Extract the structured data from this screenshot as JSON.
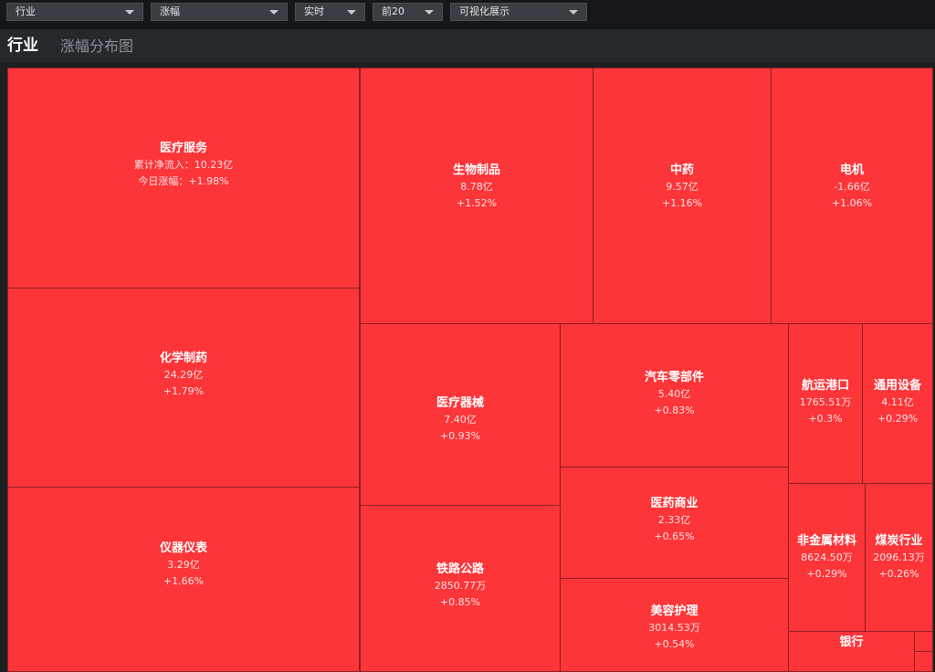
{
  "toolbar": {
    "dropdowns": [
      {
        "selected": "行业"
      },
      {
        "selected": "涨幅"
      },
      {
        "selected": "实时"
      },
      {
        "selected": "前20"
      },
      {
        "selected": "可视化展示"
      }
    ]
  },
  "header": {
    "title": "行业",
    "subtitle": "涨幅分布图"
  },
  "colors": {
    "cell_up": "#fc3539",
    "cell_border": "#8b1f22",
    "background": "#1c1e22"
  },
  "treemap": {
    "cells": [
      {
        "name": "医疗服务",
        "line1": "累计净流入：10.23亿",
        "line2": "今日涨幅：+1.98%"
      },
      {
        "name": "生物制品",
        "line1": "8.78亿",
        "line2": "+1.52%"
      },
      {
        "name": "中药",
        "line1": "9.57亿",
        "line2": "+1.16%"
      },
      {
        "name": "电机",
        "line1": "-1.66亿",
        "line2": "+1.06%"
      },
      {
        "name": "化学制药",
        "line1": "24.29亿",
        "line2": "+1.79%"
      },
      {
        "name": "医疗器械",
        "line1": "7.40亿",
        "line2": "+0.93%"
      },
      {
        "name": "汽车零部件",
        "line1": "5.40亿",
        "line2": "+0.83%"
      },
      {
        "name": "航运港口",
        "line1": "1765.51万",
        "line2": "+0.3%"
      },
      {
        "name": "通用设备",
        "line1": "4.11亿",
        "line2": "+0.29%"
      },
      {
        "name": "医药商业",
        "line1": "2.33亿",
        "line2": "+0.65%"
      },
      {
        "name": "仪器仪表",
        "line1": "3.29亿",
        "line2": "+1.66%"
      },
      {
        "name": "铁路公路",
        "line1": "2850.77万",
        "line2": "+0.85%"
      },
      {
        "name": "非金属材料",
        "line1": "8624.50万",
        "line2": "+0.29%"
      },
      {
        "name": "煤炭行业",
        "line1": "2096.13万",
        "line2": "+0.26%"
      },
      {
        "name": "美容护理",
        "line1": "3014.53万",
        "line2": "+0.54%"
      },
      {
        "name": "银行",
        "line1": "",
        "line2": ""
      },
      {
        "name": "",
        "line1": "",
        "line2": ""
      },
      {
        "name": "",
        "line1": "",
        "line2": ""
      }
    ]
  }
}
